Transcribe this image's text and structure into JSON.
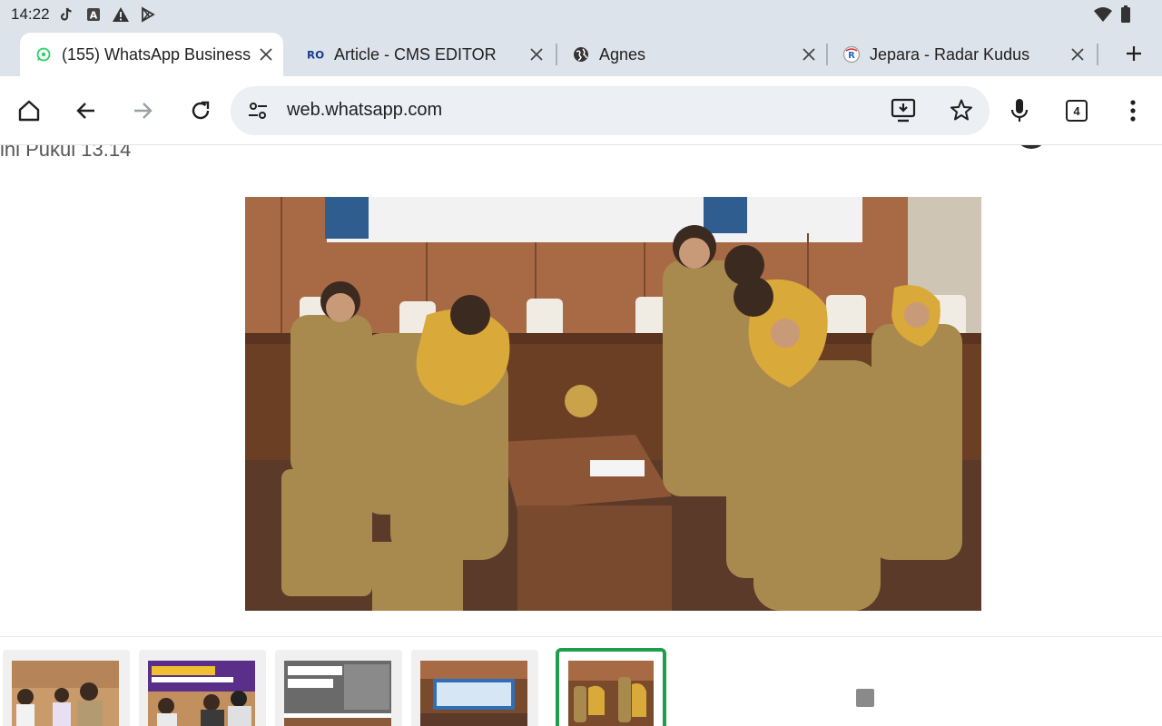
{
  "status_bar": {
    "time": "14:22",
    "icons": [
      "tiktok-icon",
      "a-badge-icon",
      "warning-icon",
      "play-store-icon"
    ],
    "right_icons": [
      "wifi-icon",
      "battery-icon"
    ]
  },
  "tabs": [
    {
      "title": "(155) WhatsApp Business",
      "favicon": "whatsapp-icon",
      "active": true
    },
    {
      "title": "Article - CMS EDITOR",
      "favicon": "ro-logo-icon",
      "active": false
    },
    {
      "title": "Agnes",
      "favicon": "globe-icon",
      "active": false
    },
    {
      "title": "Jepara - Radar Kudus",
      "favicon": "rk-logo-icon",
      "active": false
    }
  ],
  "toolbar": {
    "url": "web.whatsapp.com",
    "tab_count": "4"
  },
  "content": {
    "partial_text": "ini Pukul 13.14"
  },
  "colors": {
    "chrome_bg": "#dde3ea",
    "omnibox_bg": "#eceff3",
    "selected_thumb_border": "#1e9e4a"
  }
}
